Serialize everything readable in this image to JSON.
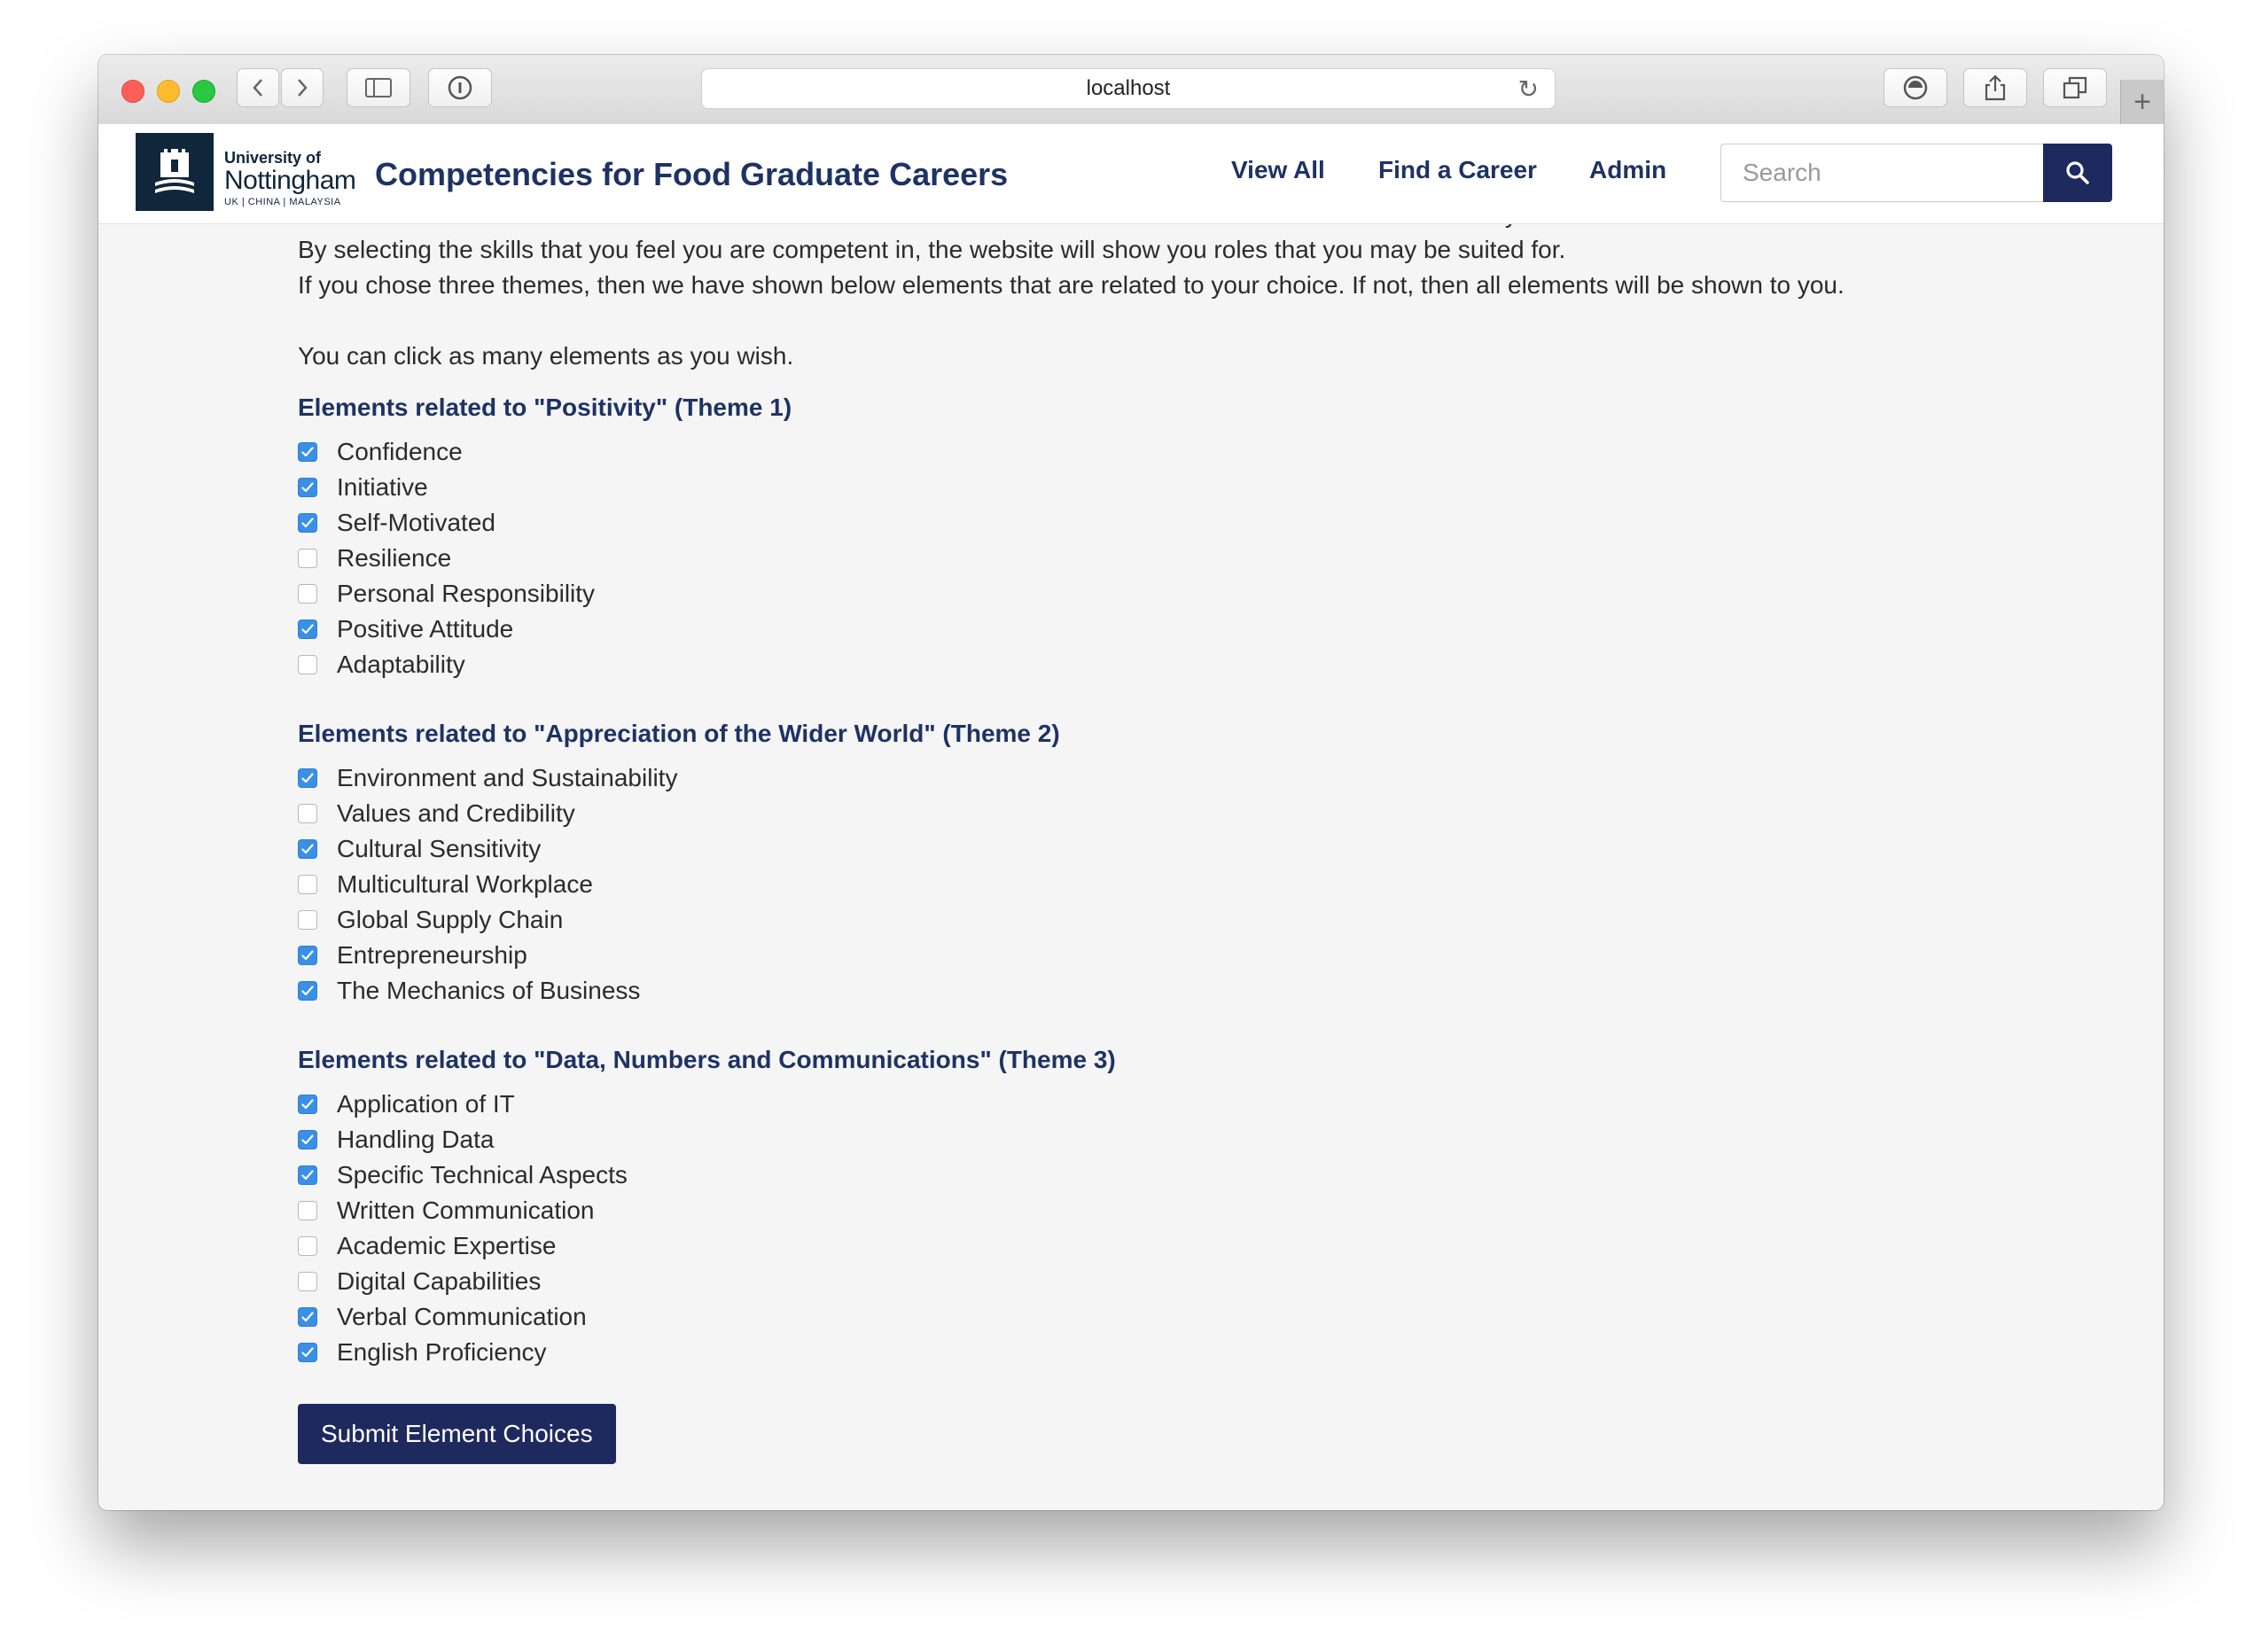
{
  "browser": {
    "url": "localhost"
  },
  "header": {
    "logo": {
      "line1": "University of",
      "line2": "Nottingham",
      "line3": "UK | CHINA | MALAYSIA"
    },
    "site_title": "Competencies for Food Graduate Careers",
    "nav": [
      "View All",
      "Find a Career",
      "Admin"
    ],
    "search": {
      "placeholder": "Search",
      "value": ""
    }
  },
  "intro": {
    "line0": "The elements below are skills that are considered desirable to various roles related to the food science industry.",
    "line1": "By selecting the skills that you feel you are competent in, the website will show you roles that you may be suited for.",
    "line2": "If you chose three themes, then we have shown below elements that are related to your choice. If not, then all elements will be shown to you.",
    "line3": "You can click as many elements as you wish."
  },
  "themes": [
    {
      "heading": "Elements related to \"Positivity\" (Theme 1)",
      "items": [
        {
          "label": "Confidence",
          "checked": true
        },
        {
          "label": "Initiative",
          "checked": true
        },
        {
          "label": "Self-Motivated",
          "checked": true
        },
        {
          "label": "Resilience",
          "checked": false
        },
        {
          "label": "Personal Responsibility",
          "checked": false
        },
        {
          "label": "Positive Attitude",
          "checked": true
        },
        {
          "label": "Adaptability",
          "checked": false
        }
      ]
    },
    {
      "heading": "Elements related to \"Appreciation of the Wider World\" (Theme 2)",
      "items": [
        {
          "label": "Environment and Sustainability",
          "checked": true
        },
        {
          "label": "Values and Credibility",
          "checked": false
        },
        {
          "label": "Cultural Sensitivity",
          "checked": true
        },
        {
          "label": "Multicultural Workplace",
          "checked": false
        },
        {
          "label": "Global Supply Chain",
          "checked": false
        },
        {
          "label": "Entrepreneurship",
          "checked": true
        },
        {
          "label": "The Mechanics of Business",
          "checked": true
        }
      ]
    },
    {
      "heading": "Elements related to \"Data, Numbers and Communications\" (Theme 3)",
      "items": [
        {
          "label": "Application of IT",
          "checked": true
        },
        {
          "label": "Handling Data",
          "checked": true
        },
        {
          "label": "Specific Technical Aspects",
          "checked": true
        },
        {
          "label": "Written Communication",
          "checked": false
        },
        {
          "label": "Academic Expertise",
          "checked": false
        },
        {
          "label": "Digital Capabilities",
          "checked": false
        },
        {
          "label": "Verbal Communication",
          "checked": true
        },
        {
          "label": "English Proficiency",
          "checked": true
        }
      ]
    }
  ],
  "submit_label": "Submit Element Choices",
  "colors": {
    "brand_navy": "#1e2a5e",
    "heading_blue": "#1e3263",
    "checkbox_blue": "#3a8fe6"
  }
}
